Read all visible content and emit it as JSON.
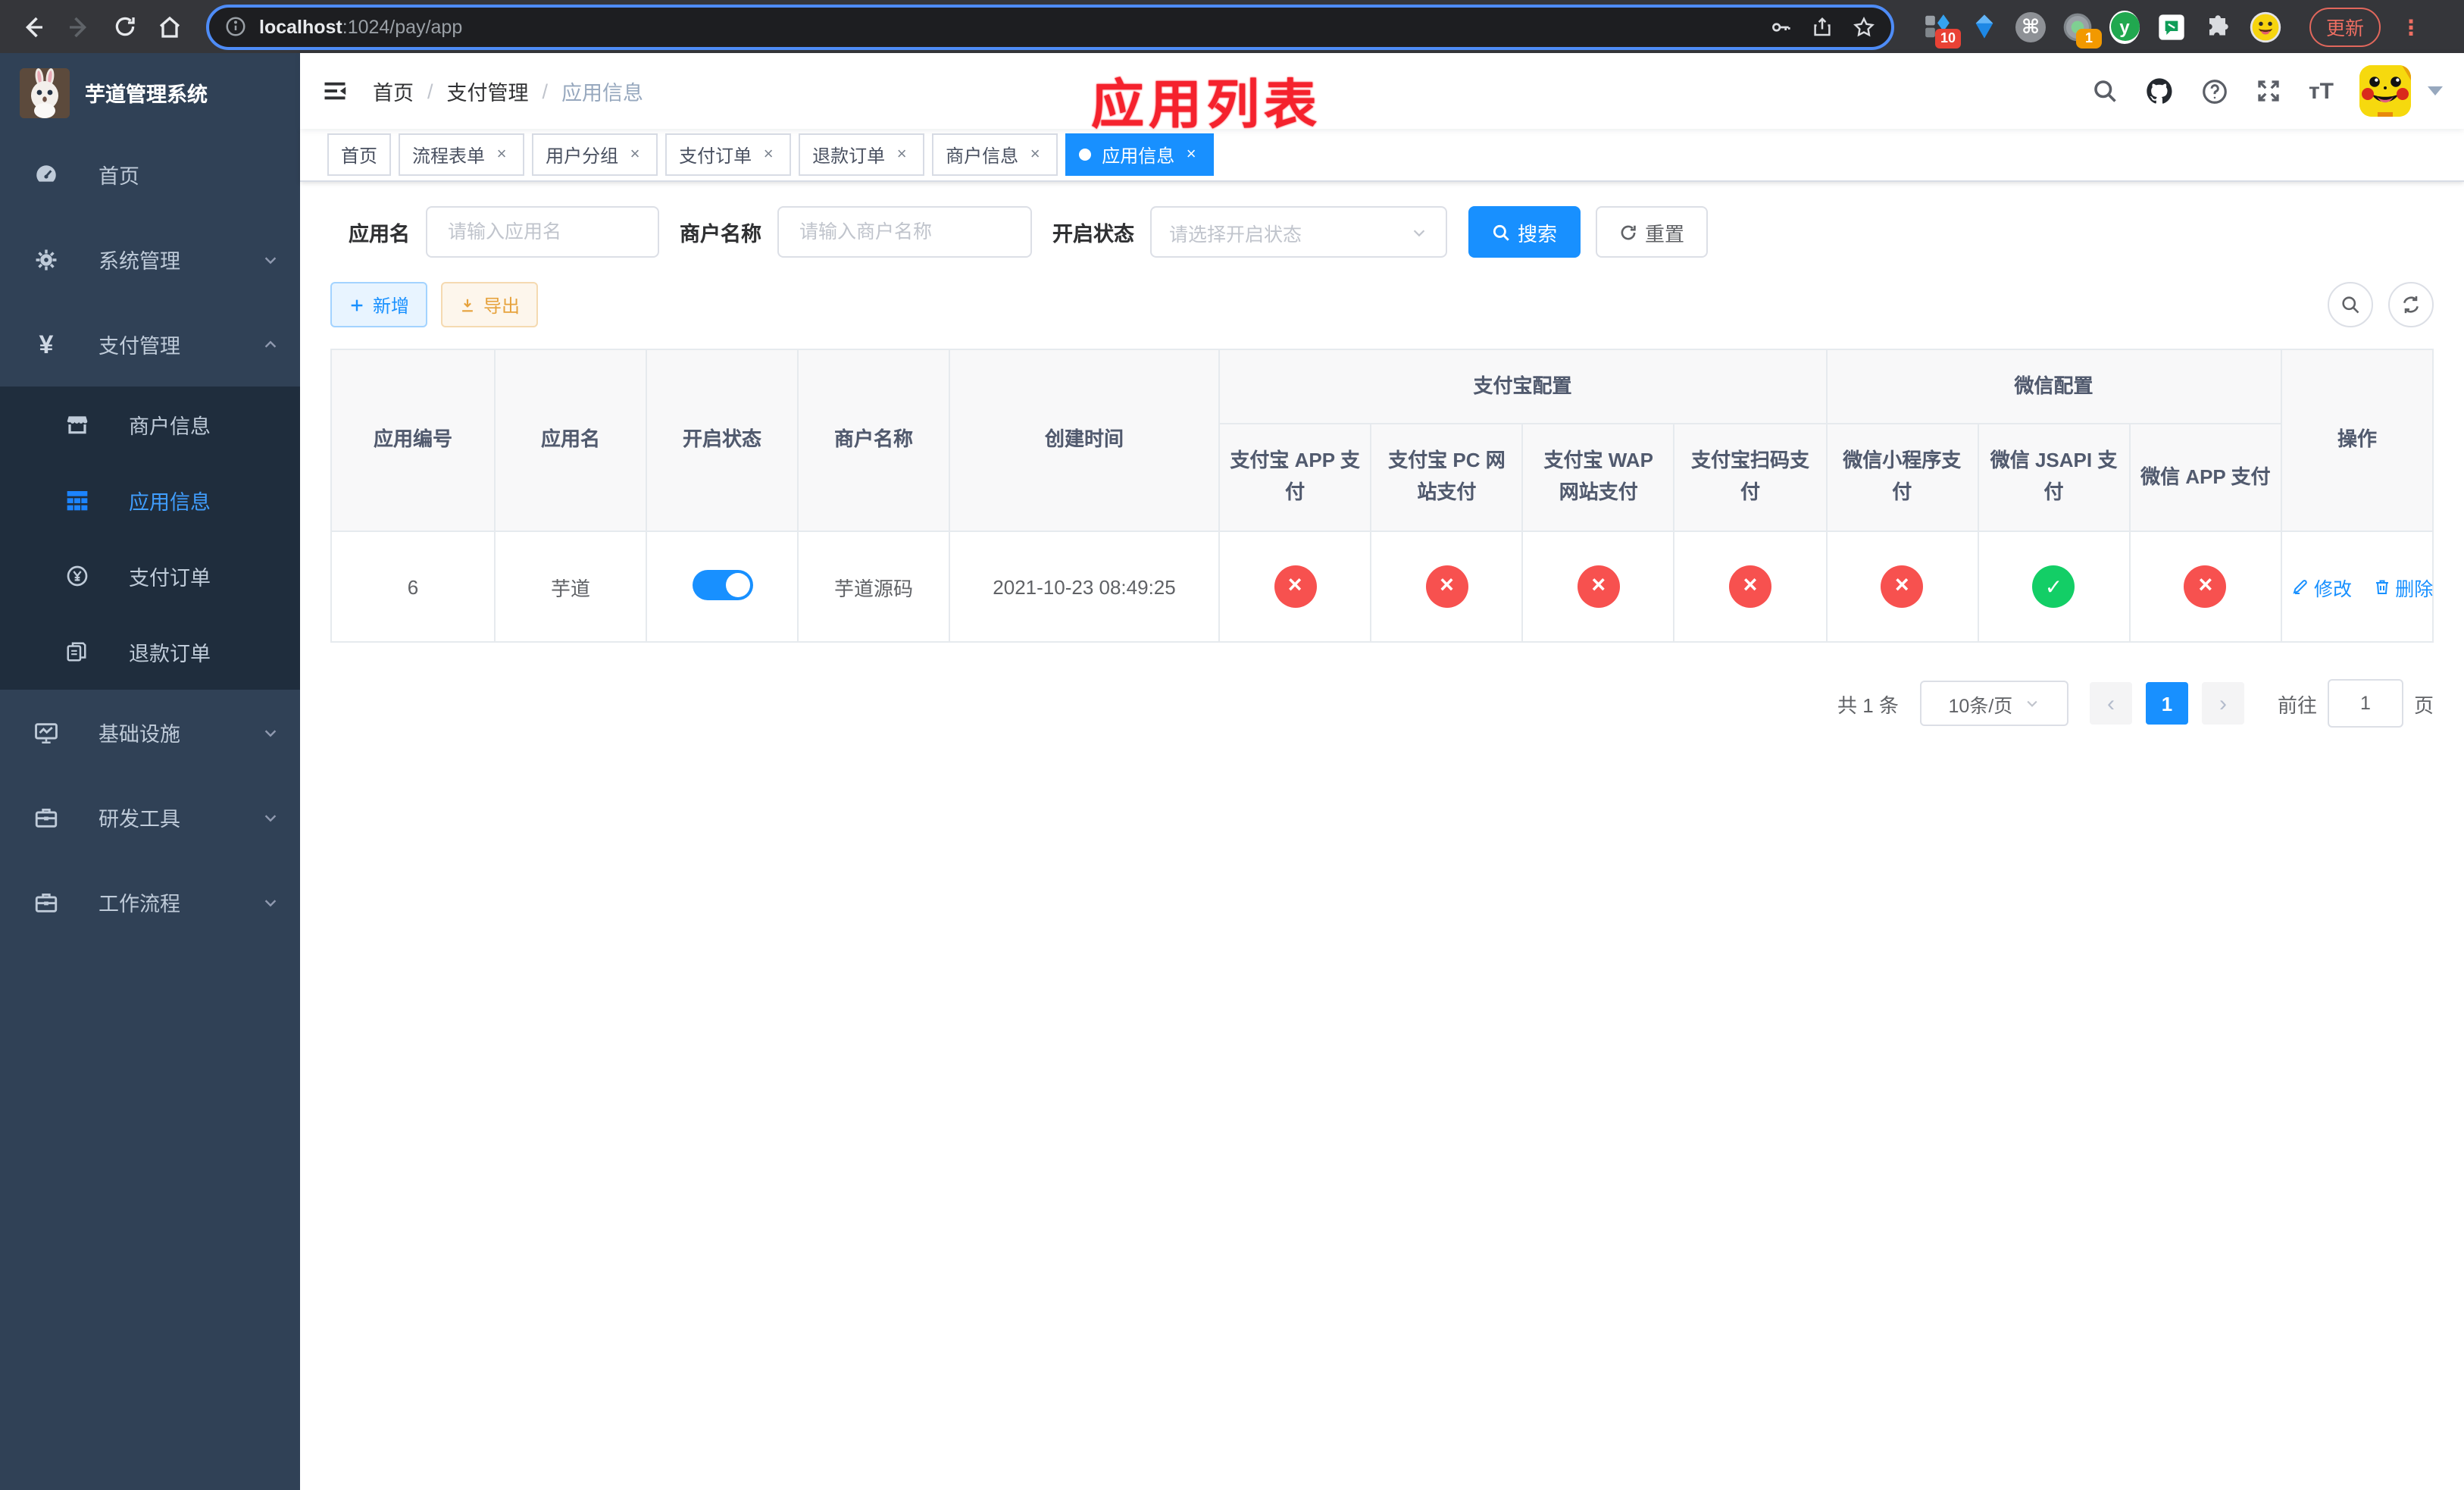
{
  "browser": {
    "url_host": "localhost",
    "url_rest": ":1024/pay/app",
    "update_label": "更新",
    "ext_badge_measure": "10",
    "ext_badge_camera": "1",
    "ext_letter": "y"
  },
  "sidebar": {
    "brand": "芋道管理系统",
    "menu": {
      "home": "首页",
      "system": "系统管理",
      "pay": "支付管理",
      "infra": "基础设施",
      "devtool": "研发工具",
      "workflow": "工作流程"
    },
    "submenu": {
      "merchant": "商户信息",
      "app": "应用信息",
      "order": "支付订单",
      "refund": "退款订单"
    }
  },
  "header": {
    "breadcrumb": [
      "首页",
      "支付管理",
      "应用信息"
    ],
    "annotation": "应用列表"
  },
  "tabs": [
    {
      "label": "首页"
    },
    {
      "label": "流程表单"
    },
    {
      "label": "用户分组"
    },
    {
      "label": "支付订单"
    },
    {
      "label": "退款订单"
    },
    {
      "label": "商户信息"
    },
    {
      "label": "应用信息"
    }
  ],
  "filters": {
    "app_name_label": "应用名",
    "app_name_placeholder": "请输入应用名",
    "merchant_label": "商户名称",
    "merchant_placeholder": "请输入商户名称",
    "status_label": "开启状态",
    "status_placeholder": "请选择开启状态",
    "search_label": "搜索",
    "reset_label": "重置"
  },
  "actions": {
    "add_label": "新增",
    "export_label": "导出"
  },
  "table": {
    "headers": {
      "id": "应用编号",
      "name": "应用名",
      "status": "开启状态",
      "merchant": "商户名称",
      "created": "创建时间",
      "alipay_group": "支付宝配置",
      "wechat_group": "微信配置",
      "ops": "操作"
    },
    "pay_cols": [
      "支付宝 APP 支付",
      "支付宝 PC 网站支付",
      "支付宝 WAP 网站支付",
      "支付宝扫码支付",
      "微信小程序支付",
      "微信 JSAPI 支付",
      "微信 APP 支付"
    ],
    "row": {
      "id": "6",
      "name": "芋道",
      "enabled": "on",
      "merchant": "芋道源码",
      "created": "2021-10-23 08:49:25",
      "statuses": [
        "no",
        "no",
        "no",
        "no",
        "no",
        "yes",
        "no"
      ],
      "edit_label": "修改",
      "delete_label": "删除"
    }
  },
  "pagination": {
    "total": "共 1 条",
    "per_page": "10条/页",
    "page": "1",
    "goto_label": "前往",
    "goto_value": "1",
    "unit": "页"
  },
  "colors": {
    "primary": "#1890ff",
    "danger": "#f7514f",
    "success": "#13ce66",
    "sidebar_bg": "#304156",
    "submenu_bg": "#1f2d3d"
  }
}
